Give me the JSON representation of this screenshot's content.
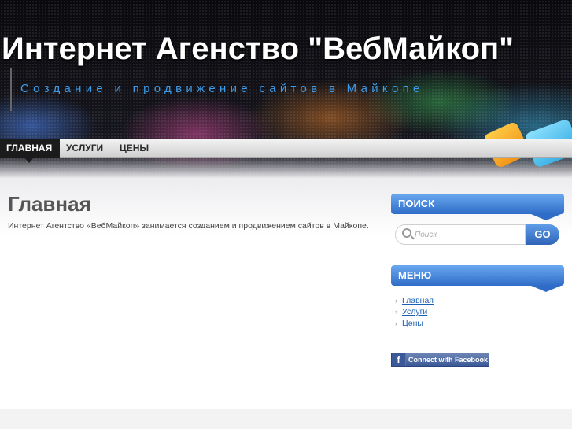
{
  "header": {
    "site_title": "Интернет Агенство \"ВебМайкоп\"",
    "tagline": "Создание и продвижение сайтов в Майкопе"
  },
  "nav": {
    "items": [
      {
        "label": "Главная",
        "active": true
      },
      {
        "label": "Услуги",
        "active": false
      },
      {
        "label": "Цены",
        "active": false
      }
    ]
  },
  "main": {
    "title": "Главная",
    "text": "Интернет Агентство «ВебМайкоп» занимается созданием и продвижением сайтов в Майкопе."
  },
  "sidebar": {
    "search": {
      "title": "Поиск",
      "placeholder": "Поиск",
      "button": "GO"
    },
    "menu": {
      "title": "Меню",
      "items": [
        "Главная",
        "Услуги",
        "Цены"
      ]
    },
    "facebook": {
      "label": "Connect with Facebook",
      "icon": "f"
    }
  },
  "colors": {
    "accent_blue": "#3d9be9",
    "widget_blue": "#2f6cc7",
    "link": "#1a5fb4"
  }
}
